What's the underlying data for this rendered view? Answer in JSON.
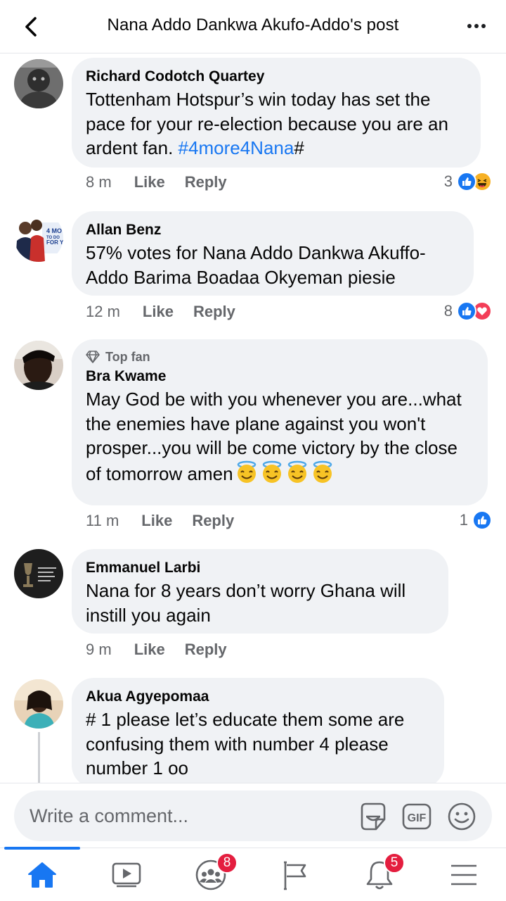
{
  "header": {
    "title": "Nana Addo Dankwa Akufo-Addo's post"
  },
  "comments": [
    {
      "author": "Richard Codotch Quartey",
      "text": "Tottenham Hotspur’s win today has set the pace for your re-election because you are an ardent fan. ",
      "hashtag": "#4more4Nana",
      "suffix": "#",
      "time": "8 m",
      "like": "Like",
      "reply": "Reply",
      "reaction_count": "3",
      "reactions": [
        "like",
        "haha"
      ]
    },
    {
      "author": "Allan Benz",
      "text": "57% votes for Nana Addo Dankwa Akuffo-Addo Barima Boadaa Okyeman piesie",
      "avatar_text": "4 MO TO DO FOR Y",
      "time": "12 m",
      "like": "Like",
      "reply": "Reply",
      "reaction_count": "8",
      "reactions": [
        "like",
        "love"
      ]
    },
    {
      "badge": "Top fan",
      "author": "Bra Kwame",
      "text": "May God be with you whenever you are...what the enemies have plane against you won't prosper...you will be come victory by the close of tomorrow amen",
      "emojis": [
        "smiling-face-with-halo",
        "smiling-face-with-halo",
        "smiling-face-with-halo",
        "smiling-face-with-halo"
      ],
      "time": "11 m",
      "like": "Like",
      "reply": "Reply",
      "reaction_count": "1",
      "reactions": [
        "like"
      ]
    },
    {
      "author": "Emmanuel Larbi",
      "text": "Nana for 8 years don’t worry Ghana will instill you again",
      "time": "9 m",
      "like": "Like",
      "reply": "Reply"
    },
    {
      "author": "Akua Agyepomaa",
      "text": "# 1 please let’s educate them some are confusing them with number 4 please number 1 oo"
    }
  ],
  "composer": {
    "placeholder": "Write a comment...",
    "gif_label": "GIF",
    "icons": [
      "sticker-icon",
      "gif-icon",
      "emoji-icon"
    ]
  },
  "nav": {
    "items": [
      {
        "name": "home",
        "active": true
      },
      {
        "name": "watch"
      },
      {
        "name": "groups",
        "badge": "8"
      },
      {
        "name": "pages"
      },
      {
        "name": "notifications",
        "badge": "5"
      },
      {
        "name": "menu"
      }
    ]
  },
  "colors": {
    "accent": "#1877f2",
    "bubble": "#f0f2f5",
    "badge": "#e41e3f",
    "secondary_text": "#65676b"
  }
}
